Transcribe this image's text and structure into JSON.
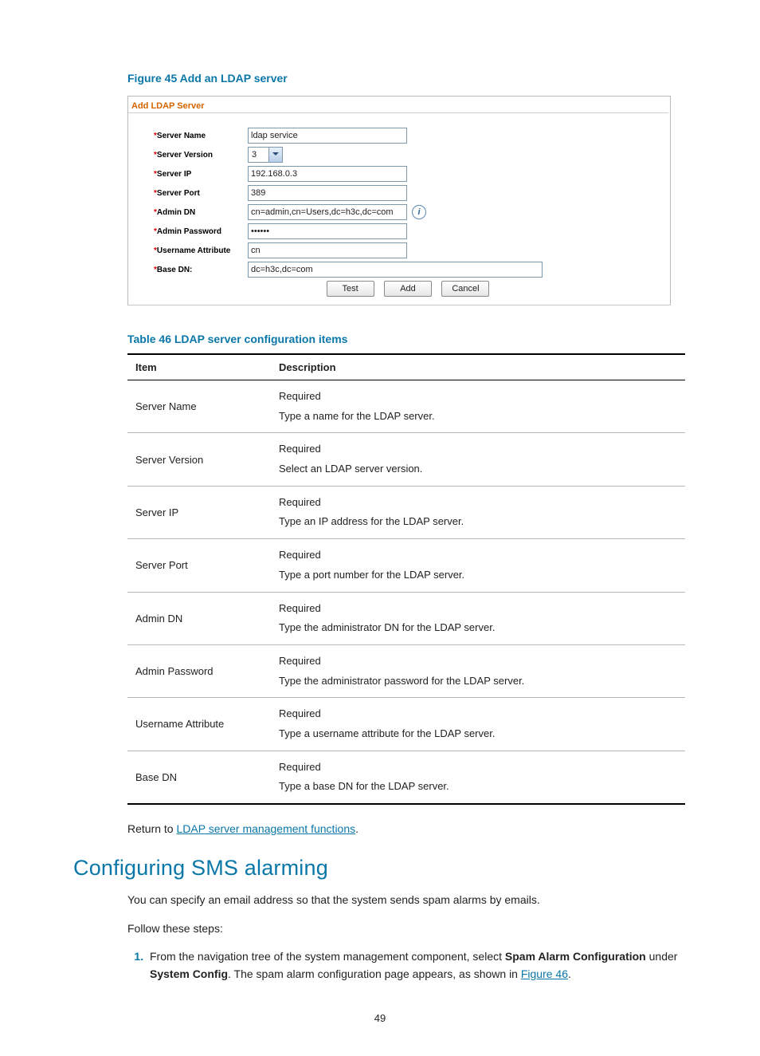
{
  "figure": {
    "caption": "Figure 45 Add an LDAP server"
  },
  "shot": {
    "title": "Add LDAP Server",
    "labels": {
      "server_name": "Server Name",
      "server_version": "Server Version",
      "server_ip": "Server IP",
      "server_port": "Server Port",
      "admin_dn": "Admin DN",
      "admin_password": "Admin Password",
      "username_attr": "Username Attribute",
      "base_dn": "Base DN:"
    },
    "values": {
      "server_name": "ldap service",
      "server_version": "3",
      "server_ip": "192.168.0.3",
      "server_port": "389",
      "admin_dn": "cn=admin,cn=Users,dc=h3c,dc=com",
      "admin_password": "••••••",
      "username_attr": "cn",
      "base_dn": "dc=h3c,dc=com"
    },
    "buttons": {
      "test": "Test",
      "add": "Add",
      "cancel": "Cancel"
    }
  },
  "table": {
    "caption": "Table 46 LDAP server configuration items",
    "headers": {
      "item": "Item",
      "desc": "Description"
    },
    "rows": [
      {
        "item": "Server Name",
        "l1": "Required",
        "l2": "Type a name for the LDAP server."
      },
      {
        "item": "Server Version",
        "l1": "Required",
        "l2": "Select an LDAP server version."
      },
      {
        "item": "Server IP",
        "l1": "Required",
        "l2": "Type an IP address for the LDAP server."
      },
      {
        "item": "Server Port",
        "l1": "Required",
        "l2": "Type a port number for the LDAP server."
      },
      {
        "item": "Admin DN",
        "l1": "Required",
        "l2": "Type the administrator DN for the LDAP server."
      },
      {
        "item": "Admin Password",
        "l1": "Required",
        "l2": "Type the administrator password for the LDAP server."
      },
      {
        "item": "Username Attribute",
        "l1": "Required",
        "l2": "Type a username attribute for the LDAP server."
      },
      {
        "item": "Base DN",
        "l1": "Required",
        "l2": "Type a base DN for the LDAP server."
      }
    ]
  },
  "return": {
    "prefix": "Return to ",
    "link": "LDAP server management functions",
    "suffix": "."
  },
  "heading": "Configuring SMS alarming",
  "para1": "You can specify an email address so that the system sends spam alarms by emails.",
  "para2": "Follow these steps:",
  "step1": {
    "t1": "From the navigation tree of the system management component, select ",
    "b1": "Spam Alarm Configuration",
    "t2": " under ",
    "b2": "System Config",
    "t3": ". The spam alarm configuration page appears, as shown in ",
    "link": "Figure 46",
    "t4": "."
  },
  "pagenum": "49"
}
